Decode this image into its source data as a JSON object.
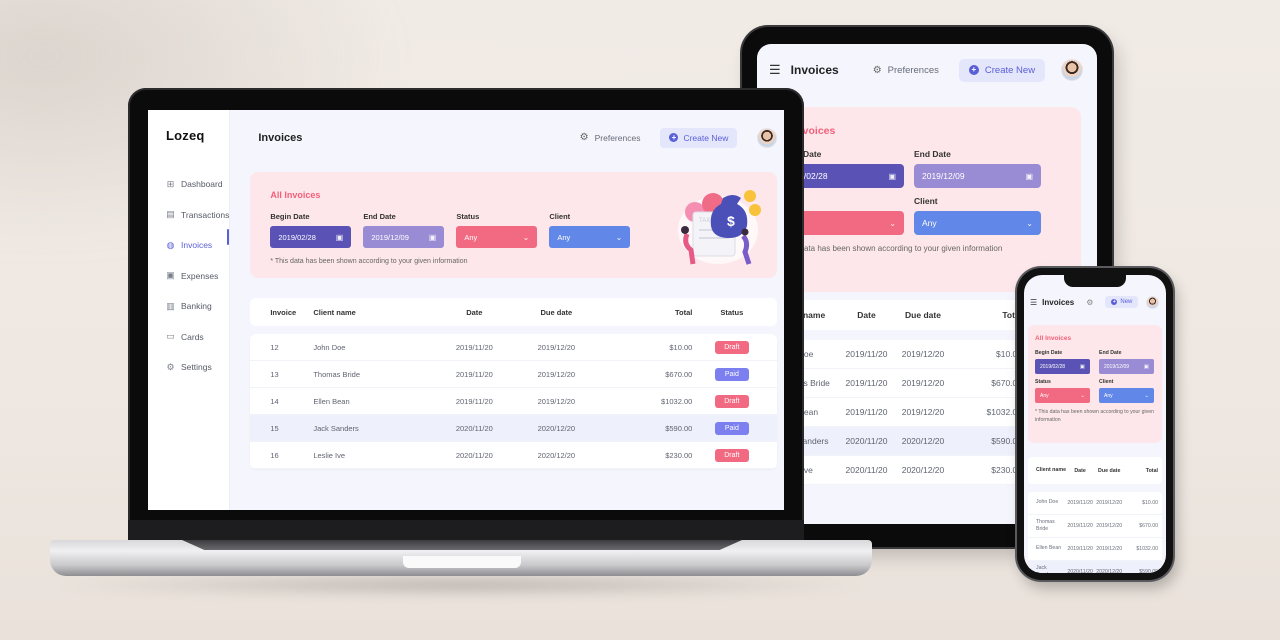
{
  "app": {
    "brand": "Lozeq",
    "page_title": "Invoices",
    "preferences_label": "Preferences",
    "create_label": "Create New",
    "create_label_short": "New"
  },
  "sidebar": {
    "items": [
      {
        "label": "Dashboard",
        "icon": "grid-icon",
        "glyph": "⊞",
        "active": false
      },
      {
        "label": "Transactions",
        "icon": "list-icon",
        "glyph": "▤",
        "active": false
      },
      {
        "label": "Invoices",
        "icon": "invoice-icon",
        "glyph": "◍",
        "active": true
      },
      {
        "label": "Expenses",
        "icon": "receipt-icon",
        "glyph": "▣",
        "active": false
      },
      {
        "label": "Banking",
        "icon": "bank-icon",
        "glyph": "▥",
        "active": false
      },
      {
        "label": "Cards",
        "icon": "card-icon",
        "glyph": "▭",
        "active": false
      },
      {
        "label": "Settings",
        "icon": "gear-icon",
        "glyph": "⚙",
        "active": false
      }
    ]
  },
  "filters": {
    "title": "All Invoices",
    "begin_date": {
      "label": "Begin Date",
      "value": "2019/02/28"
    },
    "end_date": {
      "label": "End Date",
      "value": "2019/12/09"
    },
    "status": {
      "label": "Status",
      "value": "Any"
    },
    "client": {
      "label": "Client",
      "value": "Any"
    },
    "note": "* This data has been shown according to your given information"
  },
  "table": {
    "headers": {
      "invoice": "Invoice",
      "client": "Client name",
      "date": "Date",
      "due": "Due date",
      "total": "Total",
      "status": "Status"
    },
    "rows": [
      {
        "invoice": "12",
        "client": "John Doe",
        "date": "2019/11/20",
        "due": "2019/12/20",
        "total": "$10.00",
        "status": "Draft"
      },
      {
        "invoice": "13",
        "client": "Thomas Bride",
        "date": "2019/11/20",
        "due": "2019/12/20",
        "total": "$670.00",
        "status": "Paid"
      },
      {
        "invoice": "14",
        "client": "Ellen Bean",
        "date": "2019/11/20",
        "due": "2019/12/20",
        "total": "$1032.00",
        "status": "Draft"
      },
      {
        "invoice": "15",
        "client": "Jack Sanders",
        "date": "2020/11/20",
        "due": "2020/12/20",
        "total": "$590.00",
        "status": "Paid"
      },
      {
        "invoice": "16",
        "client": "Leslie Ive",
        "date": "2020/11/20",
        "due": "2020/12/20",
        "total": "$230.00",
        "status": "Draft"
      }
    ],
    "highlighted_row": 3
  },
  "colors": {
    "accent": "#5a5fd6",
    "pink": "#f26a81",
    "begin_date_bg": "#5a52b5",
    "end_date_bg": "#9a8cd4",
    "client_bg": "#6188e8",
    "paid_badge": "#7b7ff0",
    "card_bg": "#fde7ea"
  }
}
